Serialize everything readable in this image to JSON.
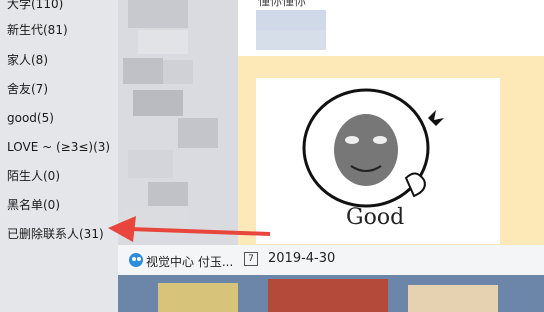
{
  "groups": [
    {
      "label": "大学(110)"
    },
    {
      "label": "新生代(81)"
    },
    {
      "label": "家人(8)"
    },
    {
      "label": "舍友(7)"
    },
    {
      "label": "good(5)"
    },
    {
      "label": "LOVE ~ (≥3≤)(3)"
    },
    {
      "label": "陌生人(0)"
    },
    {
      "label": "黑名单(0)"
    },
    {
      "label": "已删除联系人(31)"
    }
  ],
  "top_partial_text": "懂你懂你",
  "meme": {
    "caption": "Good"
  },
  "bottom_bar": {
    "app_text": "视觉中心 付玉...",
    "calendar_icon": "7",
    "date": "2019-4-30"
  },
  "colors": {
    "arrow": "#e8453c",
    "card_bg": "#fde8b8",
    "panel_bg": "#e4e6ea"
  }
}
